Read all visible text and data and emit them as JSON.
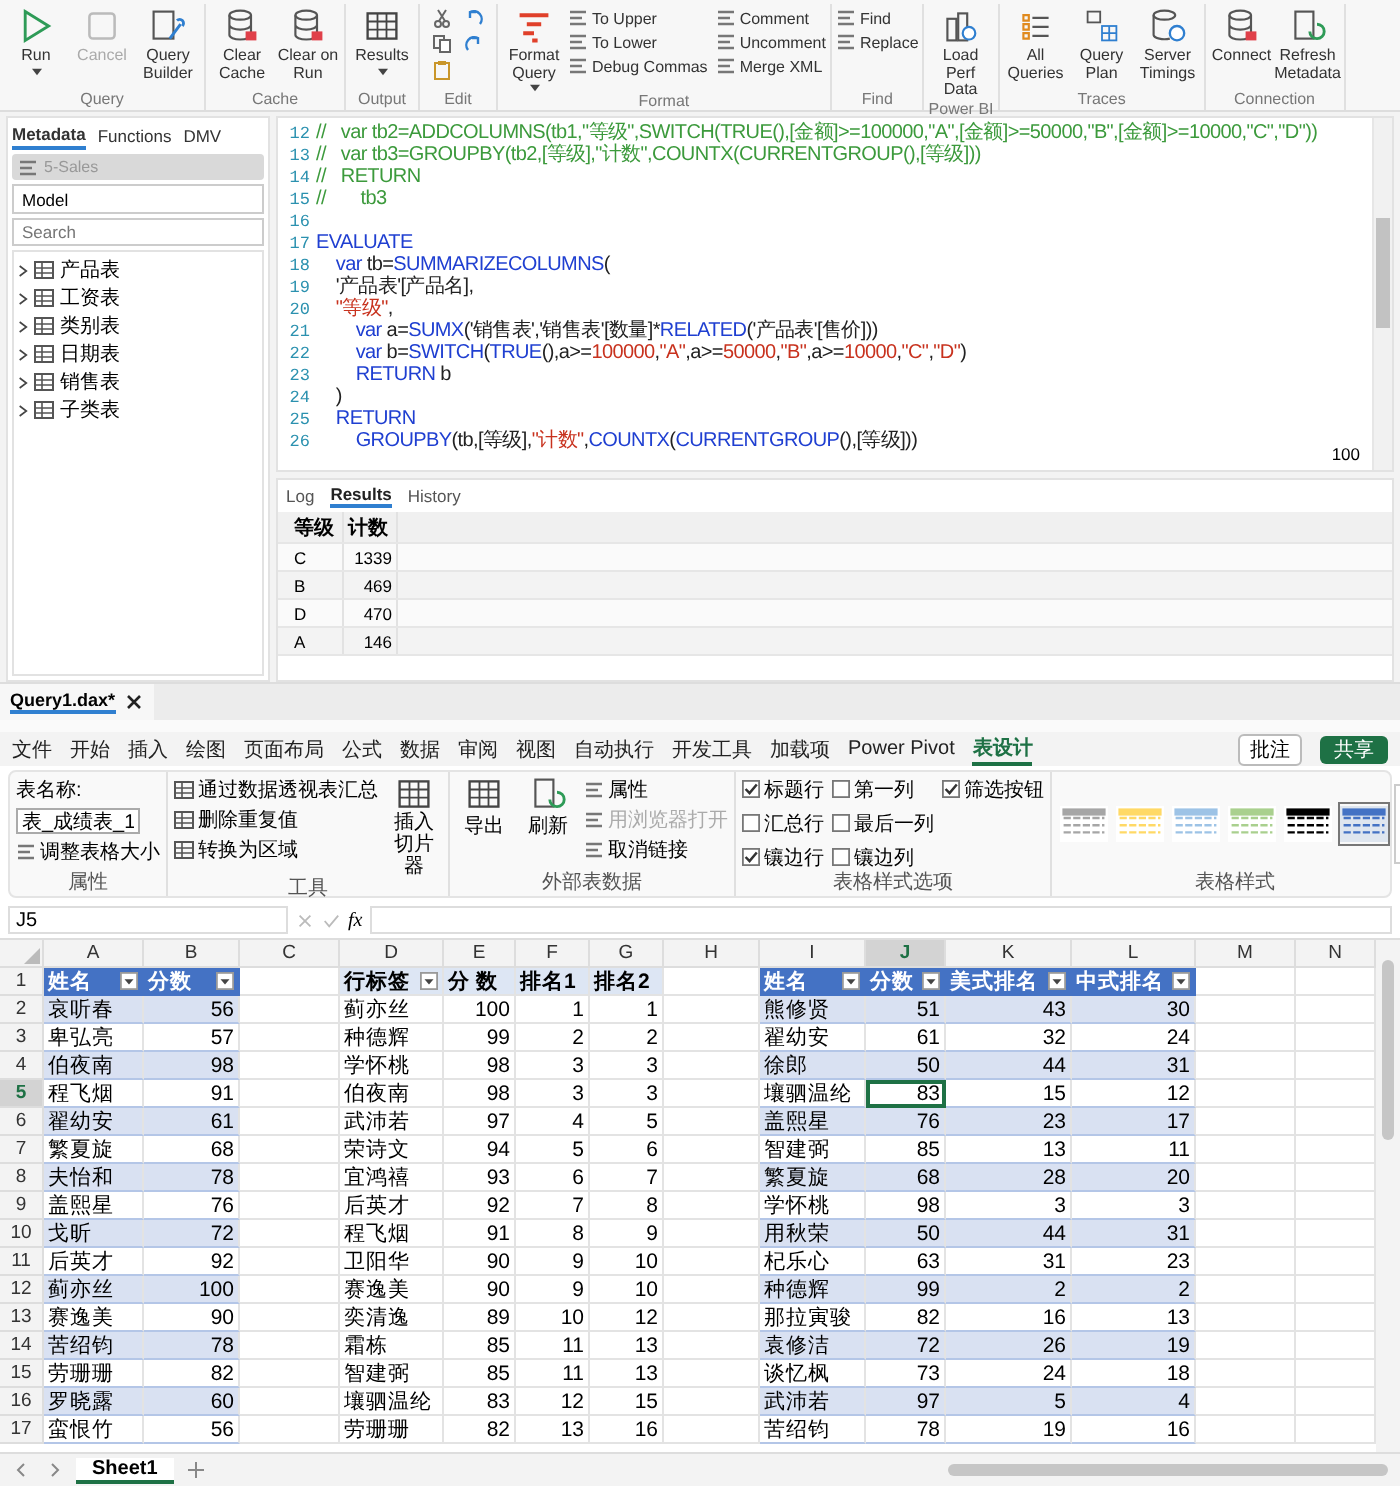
{
  "dax_ribbon": {
    "groups": [
      {
        "label": "Query",
        "buttons": [
          {
            "label": "Run",
            "kind": "large",
            "dropdown": true,
            "disabled": false
          },
          {
            "label": "Cancel",
            "kind": "large",
            "dropdown": false,
            "disabled": true
          },
          {
            "label": "Query Builder",
            "kind": "large",
            "dropdown": false,
            "disabled": false
          }
        ]
      },
      {
        "label": "Cache",
        "buttons": [
          {
            "label": "Clear Cache",
            "kind": "large",
            "dropdown": false,
            "disabled": false
          },
          {
            "label": "Clear on Run",
            "kind": "large",
            "dropdown": false,
            "disabled": false
          }
        ]
      },
      {
        "label": "Output",
        "buttons": [
          {
            "label": "Results",
            "kind": "large",
            "dropdown": true,
            "disabled": false
          }
        ]
      },
      {
        "label": "Edit"
      },
      {
        "label": "Format",
        "buttons": [
          {
            "label": "Format Query",
            "kind": "large",
            "dropdown": true,
            "disabled": false
          },
          {
            "label": "To Upper",
            "kind": "small",
            "disabled": false
          },
          {
            "label": "To Lower",
            "kind": "small",
            "disabled": false
          },
          {
            "label": "Debug Commas",
            "kind": "small",
            "disabled": false
          },
          {
            "label": "Comment",
            "kind": "small",
            "disabled": false
          },
          {
            "label": "Uncomment",
            "kind": "small",
            "disabled": false
          },
          {
            "label": "Merge XML",
            "kind": "small",
            "disabled": false
          }
        ]
      },
      {
        "label": "Find",
        "buttons": [
          {
            "label": "Find",
            "kind": "small",
            "disabled": false
          },
          {
            "label": "Replace",
            "kind": "small",
            "disabled": false
          }
        ]
      },
      {
        "label": "Power BI",
        "buttons": [
          {
            "label": "Load Perf Data",
            "kind": "large",
            "dropdown": false,
            "disabled": false
          }
        ]
      },
      {
        "label": "Traces",
        "buttons": [
          {
            "label": "All Queries",
            "kind": "large",
            "dropdown": false,
            "disabled": false
          },
          {
            "label": "Query Plan",
            "kind": "large",
            "dropdown": false,
            "disabled": false
          },
          {
            "label": "Server Timings",
            "kind": "large",
            "dropdown": false,
            "disabled": false
          }
        ]
      },
      {
        "label": "Connection",
        "buttons": [
          {
            "label": "Connect",
            "kind": "large",
            "dropdown": false,
            "disabled": false
          },
          {
            "label": "Refresh Metadata",
            "kind": "large",
            "dropdown": false,
            "disabled": false
          }
        ]
      }
    ]
  },
  "metadata_panel": {
    "tabs": [
      {
        "label": "Metadata",
        "selected": true
      },
      {
        "label": "Functions",
        "selected": false
      },
      {
        "label": "DMV",
        "selected": false
      }
    ],
    "database": "5-Sales",
    "model": "Model",
    "search": {
      "placeholder": "Search"
    },
    "tables": [
      "产品表",
      "工资表",
      "类别表",
      "日期表",
      "销售表",
      "子类表"
    ]
  },
  "editor": {
    "lines": [
      {
        "number": "12",
        "tokens": [
          {
            "kind": "comment",
            "text": "//   var tb2=ADDCOLUMNS(tb1,\"等级\",SWITCH(TRUE(),[金额]>=100000,\"A\",[金额]>=50000,\"B\",[金额]>=10000,\"C\",\"D\"))"
          }
        ]
      },
      {
        "number": "13",
        "tokens": [
          {
            "kind": "comment",
            "text": "//   var tb3=GROUPBY(tb2,[等级],\"计数\",COUNTX(CURRENTGROUP(),[等级]))"
          }
        ]
      },
      {
        "number": "14",
        "tokens": [
          {
            "kind": "comment",
            "text": "//   RETURN"
          }
        ]
      },
      {
        "number": "15",
        "tokens": [
          {
            "kind": "comment",
            "text": "//       tb3"
          }
        ]
      },
      {
        "number": "16"
      },
      {
        "number": "17",
        "tokens": [
          {
            "kind": "keyword",
            "text": "EVALUATE"
          }
        ]
      },
      {
        "number": "18",
        "tokens": [
          {
            "kind": "keyword",
            "text": "    var"
          },
          {
            "kind": "plain",
            "text": " tb="
          },
          {
            "kind": "keyword",
            "text": "SUMMARIZECOLUMNS"
          },
          {
            "kind": "plain",
            "text": "("
          }
        ]
      },
      {
        "number": "19",
        "tokens": [
          {
            "kind": "plain",
            "text": "    '产品表'[产品名],"
          }
        ]
      },
      {
        "number": "20",
        "tokens": [
          {
            "kind": "string",
            "text": "    \"等级\""
          },
          {
            "kind": "plain",
            "text": ","
          }
        ]
      },
      {
        "number": "21",
        "tokens": [
          {
            "kind": "keyword",
            "text": "        var"
          },
          {
            "kind": "plain",
            "text": " a="
          },
          {
            "kind": "keyword",
            "text": "SUMX"
          },
          {
            "kind": "plain",
            "text": "('销售表','销售表'[数量]*"
          },
          {
            "kind": "keyword",
            "text": "RELATED"
          },
          {
            "kind": "plain",
            "text": "('产品表'[售价]))"
          }
        ]
      },
      {
        "number": "22",
        "tokens": [
          {
            "kind": "keyword",
            "text": "        var"
          },
          {
            "kind": "plain",
            "text": " b="
          },
          {
            "kind": "keyword",
            "text": "SWITCH"
          },
          {
            "kind": "plain",
            "text": "("
          },
          {
            "kind": "keyword",
            "text": "TRUE"
          },
          {
            "kind": "plain",
            "text": "(),a>="
          },
          {
            "kind": "string",
            "text": "100000"
          },
          {
            "kind": "plain",
            "text": ","
          },
          {
            "kind": "string",
            "text": "\"A\""
          },
          {
            "kind": "plain",
            "text": ",a>="
          },
          {
            "kind": "string",
            "text": "50000"
          },
          {
            "kind": "plain",
            "text": ","
          },
          {
            "kind": "string",
            "text": "\"B\""
          },
          {
            "kind": "plain",
            "text": ",a>="
          },
          {
            "kind": "string",
            "text": "10000"
          },
          {
            "kind": "plain",
            "text": ","
          },
          {
            "kind": "string",
            "text": "\"C\""
          },
          {
            "kind": "plain",
            "text": ","
          },
          {
            "kind": "string",
            "text": "\"D\""
          },
          {
            "kind": "plain",
            "text": ")"
          }
        ]
      },
      {
        "number": "23",
        "tokens": [
          {
            "kind": "keyword",
            "text": "        RETURN"
          },
          {
            "kind": "plain",
            "text": " b"
          }
        ]
      },
      {
        "number": "24",
        "tokens": [
          {
            "kind": "plain",
            "text": "    )"
          }
        ]
      },
      {
        "number": "25",
        "tokens": [
          {
            "kind": "keyword",
            "text": "    RETURN"
          }
        ]
      },
      {
        "number": "26",
        "tokens": [
          {
            "kind": "keyword",
            "text": "        GROUPBY"
          },
          {
            "kind": "plain",
            "text": "(tb,[等级],"
          },
          {
            "kind": "string",
            "text": "\"计数\""
          },
          {
            "kind": "plain",
            "text": ","
          },
          {
            "kind": "keyword",
            "text": "COUNTX"
          },
          {
            "kind": "plain",
            "text": "("
          },
          {
            "kind": "keyword",
            "text": "CURRENTGROUP"
          },
          {
            "kind": "plain",
            "text": "(),[等级]))"
          }
        ]
      }
    ],
    "zoom": "100"
  },
  "output_panel": {
    "tabs": [
      {
        "label": "Log",
        "selected": false
      },
      {
        "label": "Results",
        "selected": true
      },
      {
        "label": "History",
        "selected": false
      }
    ],
    "columns": [
      "等级",
      "计数"
    ],
    "rows": [
      [
        "C",
        "1339"
      ],
      [
        "B",
        "469"
      ],
      [
        "D",
        "470"
      ],
      [
        "A",
        "146"
      ]
    ]
  },
  "document_tabs": [
    {
      "label": "Query1.dax*",
      "selected": true
    }
  ],
  "excel": {
    "menu_tabs": [
      {
        "label": "文件",
        "selected": false
      },
      {
        "label": "开始",
        "selected": false
      },
      {
        "label": "插入",
        "selected": false
      },
      {
        "label": "绘图",
        "selected": false
      },
      {
        "label": "页面布局",
        "selected": false
      },
      {
        "label": "公式",
        "selected": false
      },
      {
        "label": "数据",
        "selected": false
      },
      {
        "label": "审阅",
        "selected": false
      },
      {
        "label": "视图",
        "selected": false
      },
      {
        "label": "自动执行",
        "selected": false
      },
      {
        "label": "开发工具",
        "selected": false
      },
      {
        "label": "加载项",
        "selected": false
      },
      {
        "label": "Power Pivot",
        "selected": false
      },
      {
        "label": "表设计",
        "selected": true
      }
    ],
    "comment_button": "批注",
    "share_button": "共享",
    "ribbon": {
      "properties": {
        "label": "属性",
        "name_label": "表名称:",
        "table_name": "表_成绩表_1",
        "resize": "调整表格大小"
      },
      "tools": {
        "label": "工具",
        "items": [
          "通过数据透视表汇总",
          "删除重复值",
          "转换为区域"
        ],
        "slicer": "插入切片器"
      },
      "external": {
        "label": "外部表数据",
        "export": "导出",
        "refresh": "刷新",
        "items": [
          {
            "label": "属性",
            "disabled": false
          },
          {
            "label": "用浏览器打开",
            "disabled": true
          },
          {
            "label": "取消链接",
            "disabled": false
          }
        ]
      },
      "style_options": {
        "label": "表格样式选项",
        "options": [
          {
            "label": "标题行",
            "checked": true
          },
          {
            "label": "汇总行",
            "checked": false
          },
          {
            "label": "镶边行",
            "checked": true
          },
          {
            "label": "第一列",
            "checked": false
          },
          {
            "label": "最后一列",
            "checked": false
          },
          {
            "label": "镶边列",
            "checked": false
          },
          {
            "label": "筛选按钮",
            "checked": true
          }
        ]
      },
      "table_styles": {
        "label": "表格样式",
        "swatches": [
          {
            "color": "#a6a6a6",
            "selected": false
          },
          {
            "color": "#ffd966",
            "selected": false
          },
          {
            "color": "#9dc3e6",
            "selected": false
          },
          {
            "color": "#a9d08e",
            "selected": false
          },
          {
            "color": "#000000",
            "selected": false
          },
          {
            "color": "#4472c4",
            "selected": true
          }
        ]
      }
    },
    "name_box": "J5",
    "formula_label": "fx",
    "columns": [
      {
        "letter": "A",
        "selected": false
      },
      {
        "letter": "B",
        "selected": false
      },
      {
        "letter": "C",
        "selected": false
      },
      {
        "letter": "D",
        "selected": false
      },
      {
        "letter": "E",
        "selected": false
      },
      {
        "letter": "F",
        "selected": false
      },
      {
        "letter": "G",
        "selected": false
      },
      {
        "letter": "H",
        "selected": false
      },
      {
        "letter": "I",
        "selected": false
      },
      {
        "letter": "J",
        "selected": true
      },
      {
        "letter": "K",
        "selected": false
      },
      {
        "letter": "L",
        "selected": false
      },
      {
        "letter": "M",
        "selected": false
      },
      {
        "letter": "N",
        "selected": false
      }
    ],
    "rows": [
      {
        "number": "1",
        "selected": false
      },
      {
        "number": "2",
        "selected": false
      },
      {
        "number": "3",
        "selected": false
      },
      {
        "number": "4",
        "selected": false
      },
      {
        "number": "5",
        "selected": true
      },
      {
        "number": "6",
        "selected": false
      },
      {
        "number": "7",
        "selected": false
      },
      {
        "number": "8",
        "selected": false
      },
      {
        "number": "9",
        "selected": false
      },
      {
        "number": "10",
        "selected": false
      },
      {
        "number": "11",
        "selected": false
      },
      {
        "number": "12",
        "selected": false
      },
      {
        "number": "13",
        "selected": false
      },
      {
        "number": "14",
        "selected": false
      },
      {
        "number": "15",
        "selected": false
      },
      {
        "number": "16",
        "selected": false
      },
      {
        "number": "17",
        "selected": false
      }
    ],
    "score_table": {
      "headers": [
        "姓名",
        "分数"
      ],
      "rows": [
        [
          "哀听春",
          "56"
        ],
        [
          "卑弘亮",
          "57"
        ],
        [
          "伯夜南",
          "98"
        ],
        [
          "程飞烟",
          "91"
        ],
        [
          "翟幼安",
          "61"
        ],
        [
          "繁夏旋",
          "68"
        ],
        [
          "夫怡和",
          "78"
        ],
        [
          "盖熙星",
          "76"
        ],
        [
          "戈昕",
          "72"
        ],
        [
          "后英才",
          "92"
        ],
        [
          "蓟亦丝",
          "100"
        ],
        [
          "赛逸美",
          "90"
        ],
        [
          "苦绍钧",
          "78"
        ],
        [
          "劳珊珊",
          "82"
        ],
        [
          "罗晓露",
          "60"
        ],
        [
          "蛮恨竹",
          "56"
        ]
      ]
    },
    "pivot_table": {
      "headers": [
        "行标签",
        "分 数",
        "排名1",
        "排名2"
      ],
      "rows": [
        [
          "蓟亦丝",
          "100",
          "1",
          "1"
        ],
        [
          "种德辉",
          "99",
          "2",
          "2"
        ],
        [
          "学怀桃",
          "98",
          "3",
          "3"
        ],
        [
          "伯夜南",
          "98",
          "3",
          "3"
        ],
        [
          "武沛若",
          "97",
          "4",
          "5"
        ],
        [
          "荣诗文",
          "94",
          "5",
          "6"
        ],
        [
          "宜鸿禧",
          "93",
          "6",
          "7"
        ],
        [
          "后英才",
          "92",
          "7",
          "8"
        ],
        [
          "程飞烟",
          "91",
          "8",
          "9"
        ],
        [
          "卫阳华",
          "90",
          "9",
          "10"
        ],
        [
          "赛逸美",
          "90",
          "9",
          "10"
        ],
        [
          "奕清逸",
          "89",
          "10",
          "12"
        ],
        [
          "霜栋",
          "85",
          "11",
          "13"
        ],
        [
          "智建弼",
          "85",
          "11",
          "13"
        ],
        [
          "壤驷温纶",
          "83",
          "12",
          "15"
        ],
        [
          "劳珊珊",
          "82",
          "13",
          "16"
        ]
      ]
    },
    "rank_table": {
      "headers": [
        "姓名",
        "分数",
        "美式排名",
        "中式排名"
      ],
      "rows": [
        [
          "熊修贤",
          "51",
          "43",
          "30"
        ],
        [
          "翟幼安",
          "61",
          "32",
          "24"
        ],
        [
          "徐郎",
          "50",
          "44",
          "31"
        ],
        [
          "壤驷温纶",
          "83",
          "15",
          "12"
        ],
        [
          "盖熙星",
          "76",
          "23",
          "17"
        ],
        [
          "智建弼",
          "85",
          "13",
          "11"
        ],
        [
          "繁夏旋",
          "68",
          "28",
          "20"
        ],
        [
          "学怀桃",
          "98",
          "3",
          "3"
        ],
        [
          "用秋荣",
          "50",
          "44",
          "31"
        ],
        [
          "杞乐心",
          "63",
          "31",
          "23"
        ],
        [
          "种德辉",
          "99",
          "2",
          "2"
        ],
        [
          "那拉寅骏",
          "82",
          "16",
          "13"
        ],
        [
          "袁修洁",
          "72",
          "26",
          "19"
        ],
        [
          "谈忆枫",
          "73",
          "24",
          "18"
        ],
        [
          "武沛若",
          "97",
          "5",
          "4"
        ],
        [
          "苦绍钧",
          "78",
          "19",
          "16"
        ]
      ]
    },
    "sheet_tabs": [
      {
        "label": "Sheet1",
        "selected": true
      }
    ]
  }
}
